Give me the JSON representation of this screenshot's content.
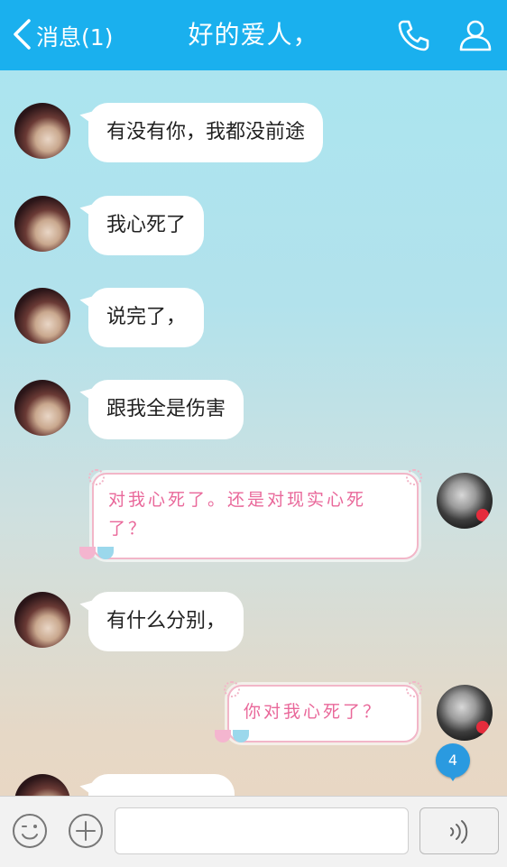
{
  "header": {
    "back_label": "消息(1)",
    "title": "好的爱人，"
  },
  "messages": [
    {
      "from": "her",
      "text": "有没有你，我都没前途"
    },
    {
      "from": "her",
      "text": "我心死了"
    },
    {
      "from": "her",
      "text": "说完了，"
    },
    {
      "from": "her",
      "text": "跟我全是伤害"
    },
    {
      "from": "me",
      "text": "对我心死了。还是对现实心死了？"
    },
    {
      "from": "her",
      "text": "有什么分别，"
    },
    {
      "from": "me",
      "text": "你对我心死了？"
    },
    {
      "from": "her",
      "text": ""
    }
  ],
  "unread_badge": "4",
  "composer": {
    "input_value": "",
    "input_placeholder": ""
  },
  "colors": {
    "header_bg": "#1ab0ee",
    "sent_text": "#e9689a",
    "sent_border": "#f2b6c8",
    "badge": "#2a9ae0"
  },
  "icons": [
    "chevron-left-icon",
    "phone-icon",
    "user-icon",
    "emoji-icon",
    "plus-icon",
    "voice-icon"
  ]
}
